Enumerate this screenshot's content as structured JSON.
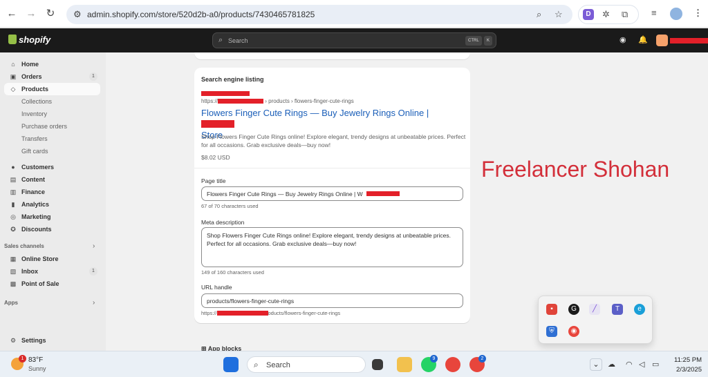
{
  "browser": {
    "url": "admin.shopify.com/store/520d2b-a0/products/7430465781825",
    "ext_letter": "D"
  },
  "topbar": {
    "brand": "shopify",
    "search_placeholder": "Search",
    "kbd_ctrl": "CTRL",
    "kbd_k": "K"
  },
  "sidebar": {
    "items": [
      {
        "label": "Home",
        "icon": "home-icon"
      },
      {
        "label": "Orders",
        "icon": "orders-icon",
        "count": "1"
      },
      {
        "label": "Products",
        "icon": "tag-icon"
      },
      {
        "label": "Collections"
      },
      {
        "label": "Inventory"
      },
      {
        "label": "Purchase orders"
      },
      {
        "label": "Transfers"
      },
      {
        "label": "Gift cards"
      },
      {
        "label": "Customers",
        "icon": "person-icon"
      },
      {
        "label": "Content",
        "icon": "content-icon"
      },
      {
        "label": "Finance",
        "icon": "bank-icon"
      },
      {
        "label": "Analytics",
        "icon": "chart-icon"
      },
      {
        "label": "Marketing",
        "icon": "target-icon"
      },
      {
        "label": "Discounts",
        "icon": "discount-icon"
      }
    ],
    "sales_channels_label": "Sales channels",
    "channels": [
      {
        "label": "Online Store",
        "icon": "store-icon"
      },
      {
        "label": "Inbox",
        "icon": "inbox-icon",
        "count": "1"
      },
      {
        "label": "Point of Sale",
        "icon": "pos-icon"
      }
    ],
    "apps_label": "Apps",
    "settings_label": "Settings"
  },
  "seo": {
    "title": "Search engine listing",
    "breadcrumb_prefix": "https://",
    "breadcrumb_suffix": "› products › flowers-finger-cute-rings",
    "preview_title": "Flowers Finger Cute Rings — Buy Jewelry Rings Online |",
    "preview_title_tail": "Store",
    "preview_description": "Shop Flowers Finger Cute Rings online! Explore elegant, trendy designs at unbeatable prices. Perfect for all occasions. Grab exclusive deals—buy now!",
    "price": "$8.02 USD",
    "page_title_label": "Page title",
    "page_title_value": "Flowers Finger Cute Rings — Buy Jewelry Rings Online | W",
    "page_title_help": "67 of 70 characters used",
    "meta_label": "Meta description",
    "meta_value": "Shop Flowers Finger Cute Rings online! Explore elegant, trendy designs at unbeatable prices. Perfect for all occasions. Grab exclusive deals—buy now!",
    "meta_help": "149 of 160 characters used",
    "url_label": "URL handle",
    "url_value": "products/flowers-finger-cute-rings",
    "url_help_prefix": "https://",
    "url_help_suffix": "oducts/flowers-finger-cute-rings"
  },
  "app_blocks": "App blocks",
  "watermark": "Freelancer Shohan",
  "taskbar": {
    "temp": "83°F",
    "condition": "Sunny",
    "weather_badge": "1",
    "search": "Search",
    "whatsapp_badge": "9",
    "chrome_badge": "2",
    "time": "11:25 PM",
    "date": "2/3/2025"
  },
  "colors": {
    "accent_link": "#1a5eb8",
    "redaction": "#e32029",
    "shopify_green": "#95bf47"
  }
}
